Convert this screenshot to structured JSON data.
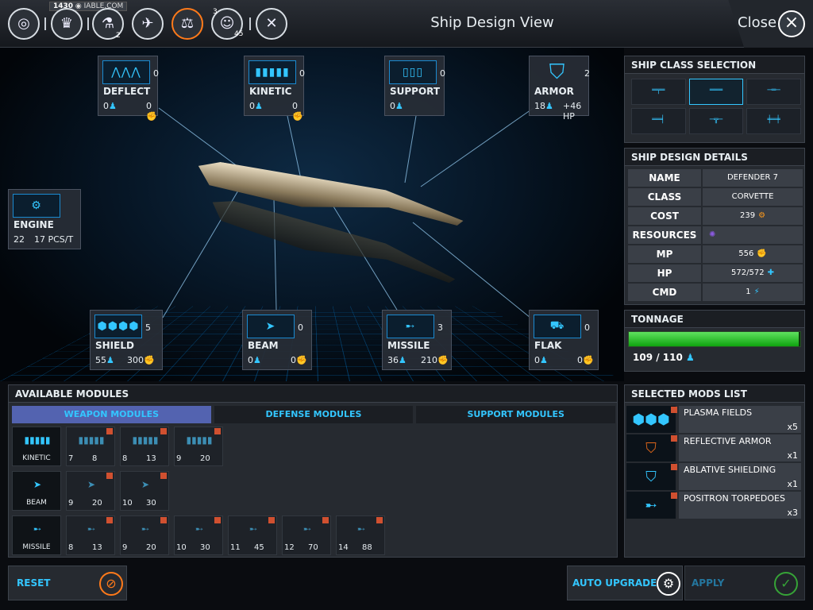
{
  "header": {
    "title": "Ship Design View",
    "close_label": "Close",
    "resource_value": "1430",
    "resource_text": "IABLE.COM",
    "badge_tech": "2",
    "badge_pop_top": "3",
    "badge_pop": "45"
  },
  "modules_display": {
    "deflect": {
      "name": "DEFLECT",
      "count": "0",
      "left": "0",
      "right": "0"
    },
    "kinetic": {
      "name": "KINETIC",
      "count": "0",
      "left": "0",
      "right": "0"
    },
    "support": {
      "name": "SUPPORT",
      "count": "0",
      "left": "0",
      "right": ""
    },
    "armor": {
      "name": "ARMOR",
      "count": "2",
      "left": "18",
      "right": "+46 HP"
    },
    "engine": {
      "name": "ENGINE",
      "count": "22",
      "right": "17 PCS/T"
    },
    "shield": {
      "name": "SHIELD",
      "count": "5",
      "left": "55",
      "right": "300"
    },
    "beam": {
      "name": "BEAM",
      "count": "0",
      "left": "0",
      "right": "0"
    },
    "missile": {
      "name": "MISSILE",
      "count": "3",
      "left": "36",
      "right": "210"
    },
    "flak": {
      "name": "FLAK",
      "count": "0",
      "left": "0",
      "right": "0"
    }
  },
  "ship_class": {
    "title": "SHIP CLASS SELECTION",
    "selected_index": 1
  },
  "details": {
    "title": "SHIP DESIGN DETAILS",
    "rows": [
      {
        "key": "NAME",
        "value": "DEFENDER 7"
      },
      {
        "key": "CLASS",
        "value": "CORVETTE"
      },
      {
        "key": "COST",
        "value": "239"
      },
      {
        "key": "RESOURCES",
        "value": ""
      },
      {
        "key": "MP",
        "value": "556"
      },
      {
        "key": "HP",
        "value": "572/572"
      },
      {
        "key": "CMD",
        "value": "1"
      }
    ]
  },
  "tonnage": {
    "title": "TONNAGE",
    "label": "109 / 110",
    "fraction": 0.991
  },
  "available": {
    "title": "AVAILABLE MODULES",
    "tabs": [
      "WEAPON MODULES",
      "DEFENSE MODULES",
      "SUPPORT MODULES"
    ],
    "kinetic_label": "KINETIC",
    "beam_label": "BEAM",
    "missile_label": "MISSILE",
    "kinetic": [
      {
        "a": "7",
        "b": "8"
      },
      {
        "a": "8",
        "b": "13"
      },
      {
        "a": "9",
        "b": "20"
      }
    ],
    "beam": [
      {
        "a": "9",
        "b": "20"
      },
      {
        "a": "10",
        "b": "30"
      }
    ],
    "missile": [
      {
        "a": "8",
        "b": "13"
      },
      {
        "a": "9",
        "b": "20"
      },
      {
        "a": "10",
        "b": "30"
      },
      {
        "a": "11",
        "b": "45"
      },
      {
        "a": "12",
        "b": "70"
      },
      {
        "a": "14",
        "b": "88"
      }
    ]
  },
  "selected": {
    "title": "SELECTED MODS LIST",
    "items": [
      {
        "name": "PLASMA FIELDS",
        "count": "x5"
      },
      {
        "name": "REFLECTIVE ARMOR",
        "count": "x1"
      },
      {
        "name": "ABLATIVE SHIELDING",
        "count": "x1"
      },
      {
        "name": "POSITRON TORPEDOES",
        "count": "x3"
      }
    ]
  },
  "actions": {
    "reset": "RESET",
    "auto_upgrade": "AUTO UPGRADE",
    "apply": "APPLY"
  },
  "colors": {
    "accent": "#33c6ff",
    "tonnage": "#1fbf1f",
    "active_tab": "#5363b0",
    "orange": "#ff7a1a"
  }
}
